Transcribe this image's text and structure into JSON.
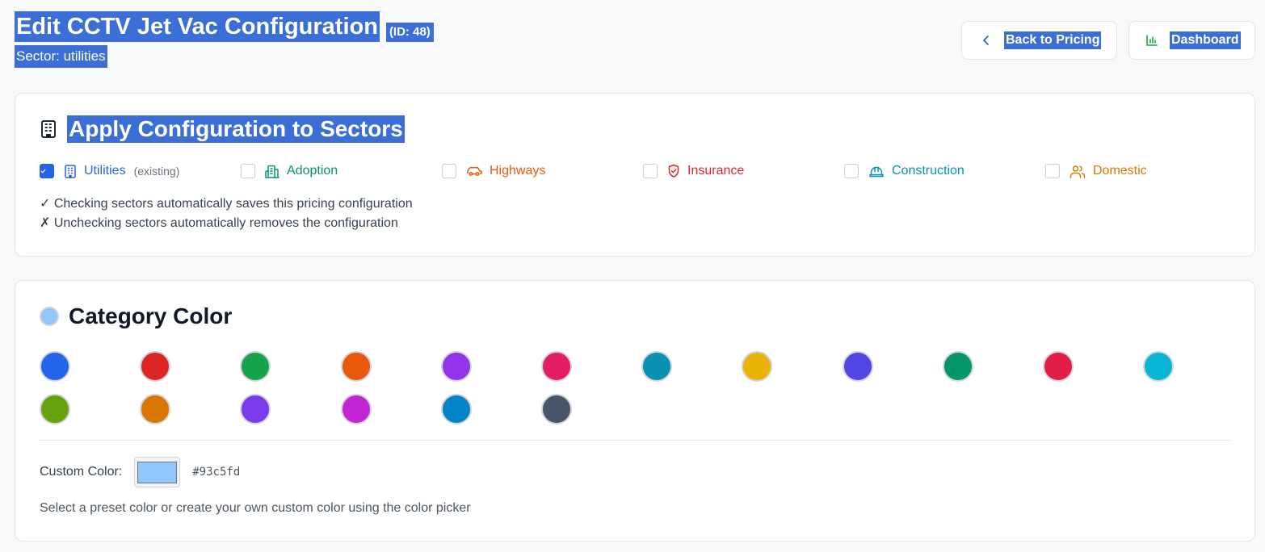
{
  "header": {
    "title": "Edit CCTV Jet Vac Configuration",
    "id_label": "(ID: 48)",
    "subtitle": "Sector: utilities",
    "back_label": "Back to Pricing",
    "dashboard_label": "Dashboard",
    "back_icon": "chevron-left-icon",
    "dashboard_icon": "bar-chart-icon"
  },
  "sectors_card": {
    "title": "Apply Configuration to Sectors",
    "title_icon": "building-icon",
    "sectors": [
      {
        "label": "Utilities",
        "checked": true,
        "tag": "(existing)",
        "color": "#2563eb",
        "icon": "building-icon"
      },
      {
        "label": "Adoption",
        "checked": false,
        "tag": "",
        "color": "#059669",
        "icon": "building-2-icon"
      },
      {
        "label": "Highways",
        "checked": false,
        "tag": "",
        "color": "#ea580c",
        "icon": "car-icon"
      },
      {
        "label": "Insurance",
        "checked": false,
        "tag": "",
        "color": "#dc2626",
        "icon": "shield-icon"
      },
      {
        "label": "Construction",
        "checked": false,
        "tag": "",
        "color": "#0891b2",
        "icon": "hard-hat-icon"
      },
      {
        "label": "Domestic",
        "checked": false,
        "tag": "",
        "color": "#d97706",
        "icon": "users-icon"
      }
    ],
    "note_check": "✓ Checking sectors automatically saves this pricing configuration",
    "note_uncheck": "✗ Unchecking sectors automatically removes the configuration"
  },
  "color_card": {
    "title": "Category Color",
    "current_color": "#93c5fd",
    "presets": [
      "#2563eb",
      "#dc2626",
      "#16a34a",
      "#ea580c",
      "#9333ea",
      "#e11d64",
      "#0891b2",
      "#eab308",
      "#4f46e5",
      "#059669",
      "#e11d48",
      "#06b6d4",
      "#65a30d",
      "#d97706",
      "#7c3aed",
      "#c026d3",
      "#0284c7",
      "#475569"
    ],
    "custom_label": "Custom Color:",
    "custom_value": "#93c5fd",
    "help_text": "Select a preset color or create your own custom color using the color picker"
  }
}
